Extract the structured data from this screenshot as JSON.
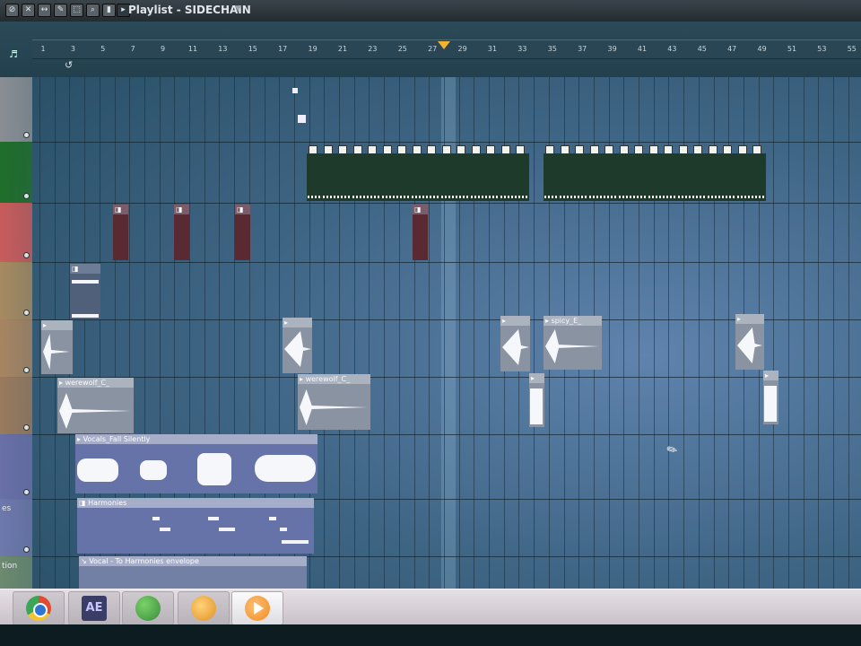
{
  "toolbar": {
    "title": "Playlist - SIDECHAIN",
    "buttons": [
      "stop-icon",
      "snap-icon",
      "pan-icon",
      "draw-icon",
      "select-icon",
      "zoom-icon",
      "slice-icon",
      "play-icon"
    ]
  },
  "ruler": {
    "bars": [
      "1",
      "3",
      "5",
      "7",
      "9",
      "11",
      "13",
      "15",
      "17",
      "19",
      "21",
      "23",
      "25",
      "27",
      "29",
      "31",
      "33",
      "35",
      "37",
      "39",
      "41",
      "43",
      "45",
      "47",
      "49",
      "51",
      "53",
      "55"
    ]
  },
  "tracks": [
    {
      "color": "#8a8e94",
      "label": ""
    },
    {
      "color": "#1f6e2a",
      "label": ""
    },
    {
      "color": "#c95b5b",
      "label": ""
    },
    {
      "color": "#a68a60",
      "label": ""
    },
    {
      "color": "#a88562",
      "label": ""
    },
    {
      "color": "#9a7a5c",
      "label": ""
    },
    {
      "color": "#6a6fa8",
      "label": ""
    },
    {
      "color": "#6e78ac",
      "label": "es"
    },
    {
      "color": "#6c8a6e",
      "label": "tion"
    }
  ],
  "clips": {
    "werewolf_1": "werewolf_C_",
    "werewolf_2": "werewolf_C_",
    "spicy": "spicy_E_",
    "vocals": "Vocals_Fall Silently",
    "harmonies": "Harmonies",
    "envelope": "Vocal - To Harmonies envelope"
  },
  "taskbar": [
    {
      "name": "chrome",
      "color": "#e24b32"
    },
    {
      "name": "after-effects",
      "label": "AE",
      "color": "#3a3d66"
    },
    {
      "name": "messenger",
      "color": "#5bb04a"
    },
    {
      "name": "fl-studio",
      "color": "#e7a52a"
    },
    {
      "name": "media-player",
      "color": "#f08a1c"
    }
  ]
}
